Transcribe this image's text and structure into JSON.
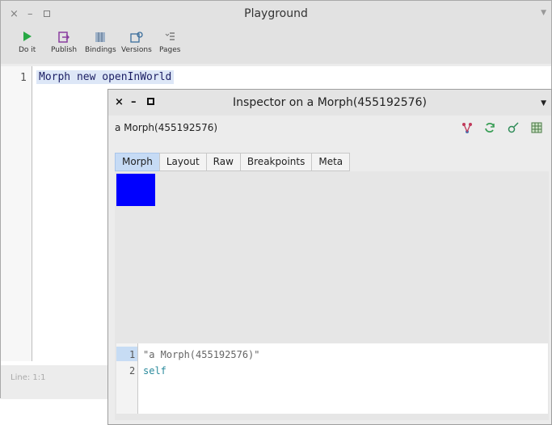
{
  "playground": {
    "title": "Playground",
    "controls": {
      "close": "×",
      "minimize": "–"
    },
    "toolbar": [
      {
        "label": "Do it",
        "icon": "play-icon",
        "color": "#27a844"
      },
      {
        "label": "Publish",
        "icon": "publish-icon",
        "color": "#8a3da0"
      },
      {
        "label": "Bindings",
        "icon": "bindings-icon",
        "color": "#556f8c"
      },
      {
        "label": "Versions",
        "icon": "versions-icon",
        "color": "#3b6e9c"
      },
      {
        "label": "Pages",
        "icon": "pages-icon",
        "color": "#666666"
      }
    ],
    "editor": {
      "line_number": "1",
      "code": "Morph new openInWorld"
    },
    "status": "Line: 1:1"
  },
  "inspector": {
    "title": "Inspector on a Morph(455192576)",
    "controls": {
      "close": "×",
      "minimize": "–"
    },
    "subject": "a Morph(455192576)",
    "tabs": [
      "Morph",
      "Layout",
      "Raw",
      "Breakpoints",
      "Meta"
    ],
    "active_tab": "Morph",
    "morph_color": "#0000ff",
    "actions": [
      "browse-icon",
      "refresh-icon",
      "inspect-icon",
      "table-icon"
    ],
    "evaluator": {
      "lines": [
        {
          "n": "1",
          "text": "\"a Morph(455192576)\"",
          "color": "#666666"
        },
        {
          "n": "2",
          "text": "self",
          "color": "#2a8a9c"
        }
      ]
    }
  }
}
